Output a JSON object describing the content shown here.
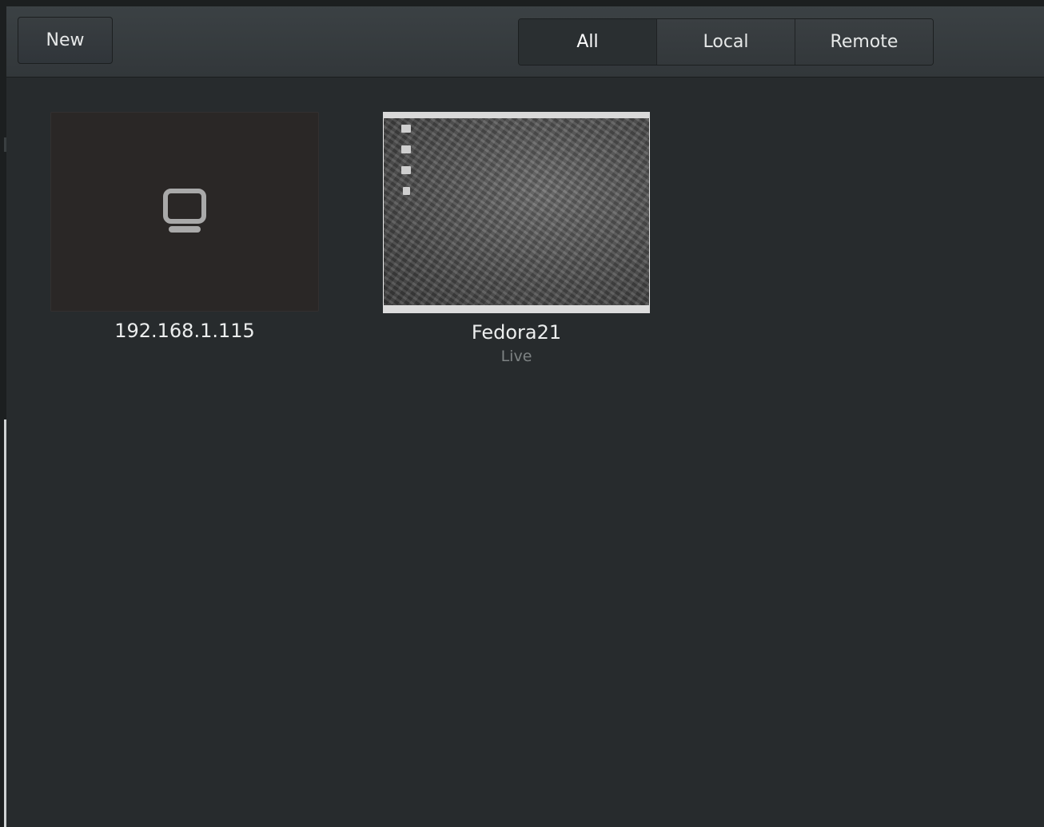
{
  "header": {
    "new_label": "New",
    "filters": [
      {
        "label": "All",
        "active": true
      },
      {
        "label": "Local",
        "active": false
      },
      {
        "label": "Remote",
        "active": false
      }
    ]
  },
  "boxes": [
    {
      "title": "192.168.1.115",
      "subtitle": "",
      "icon": "computer-icon"
    },
    {
      "title": "Fedora21",
      "subtitle": "Live",
      "icon": "screenshot-thumbnail"
    }
  ]
}
